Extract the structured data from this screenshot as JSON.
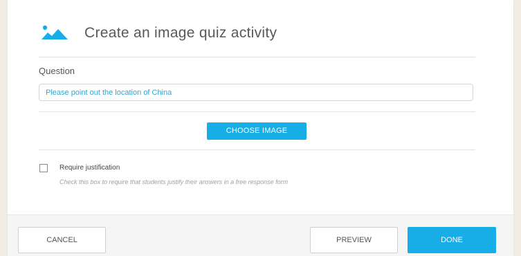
{
  "dialog": {
    "title": "Create an image quiz activity",
    "icon": "image-landscape-icon",
    "accent_color": "#17aee8"
  },
  "question": {
    "label": "Question",
    "value": "Please point out the location of China",
    "placeholder": ""
  },
  "choose_image": {
    "label": "CHOOSE IMAGE"
  },
  "justification": {
    "checked": false,
    "label": "Require justification",
    "help": "Check this box to require that students justify their answers in a free response form"
  },
  "footer": {
    "cancel_label": "CANCEL",
    "preview_label": "PREVIEW",
    "done_label": "DONE"
  }
}
